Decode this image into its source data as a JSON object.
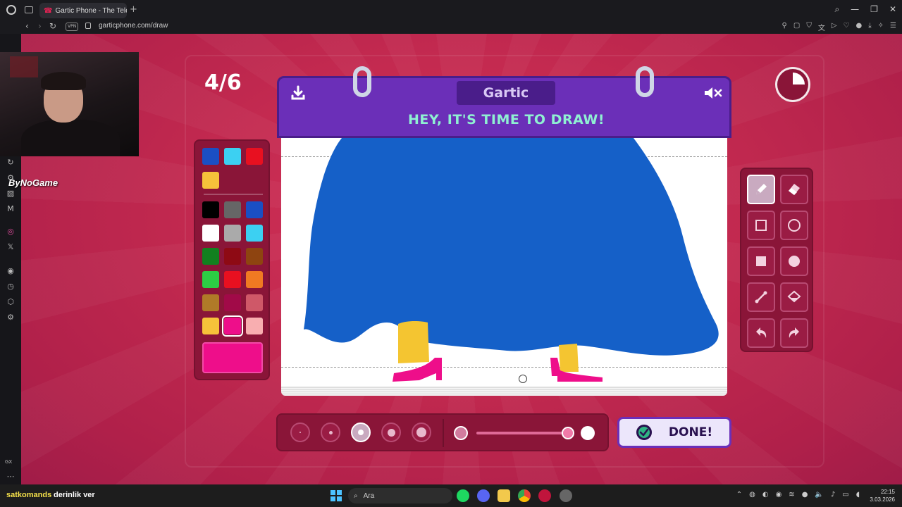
{
  "browser": {
    "tab_title": "Gartic Phone - The Teleph",
    "url": "garticphone.com/draw",
    "vpn_badge": "VPN"
  },
  "overlay": {
    "streamer_name": "ByNoGame"
  },
  "game": {
    "round_counter": "4/6",
    "logo_text": "Gartic",
    "prompt_title": "HEY, IT'S TIME TO DRAW!",
    "done_label": "DONE!",
    "timer_fraction_elapsed": 0.25,
    "palette_top": [
      "#1a4fc4",
      "#3cd0f2",
      "#e81020",
      "#f6c23a"
    ],
    "palette_main": [
      "#000000",
      "#666666",
      "#1a4fc4",
      "#ffffff",
      "#aaaaaa",
      "#3cd0f2",
      "#12801f",
      "#8e0a14",
      "#8e4410",
      "#2ccd44",
      "#e81020",
      "#f07a22",
      "#b07a28",
      "#a10a48",
      "#cf5868",
      "#f6c23a",
      "#ee0e8a",
      "#f8aeb0"
    ],
    "selected_color": "#ee0e8a",
    "tools": [
      "pencil-icon",
      "eraser-icon",
      "rectangle-outline-icon",
      "circle-outline-icon",
      "rectangle-filled-icon",
      "circle-filled-icon",
      "line-icon",
      "fill-bucket-icon",
      "undo-icon",
      "redo-icon"
    ],
    "active_tool": "pencil-icon",
    "brush_sizes": 5,
    "active_brush_size_index": 2,
    "opacity_fraction": 1.0
  },
  "taskbar": {
    "username": "satkomands",
    "message": "derinlik ver",
    "search_placeholder": "Ara",
    "time": "22:15",
    "date": "3.03.2026"
  },
  "colors": {
    "accent": "#6b2fb8",
    "title_green": "#8ff0d2",
    "background": "#c42a50"
  }
}
